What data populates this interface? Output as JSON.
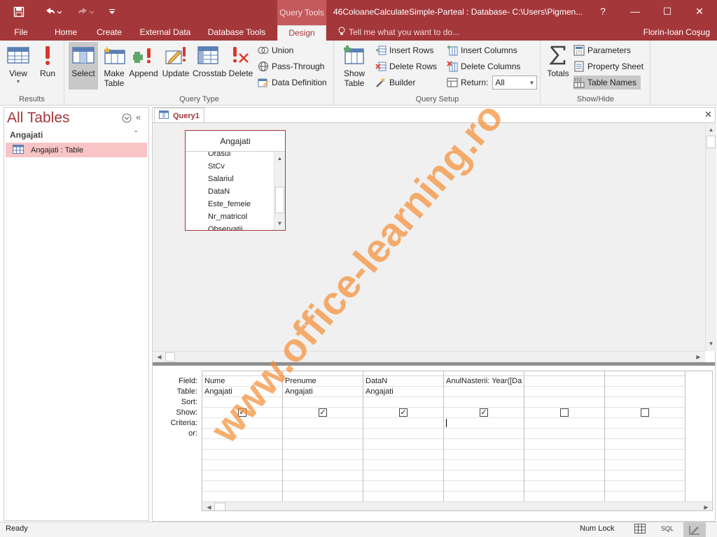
{
  "titlebar": {
    "context_tab": "Query Tools",
    "document_title": "46ColoaneCalculateSimple-Parteal : Database- C:\\Users\\Pigmen...",
    "help": "?",
    "minimize": "—",
    "restore": "☐",
    "close": "✕"
  },
  "ribbon_tabs": {
    "file": "File",
    "home": "Home",
    "create": "Create",
    "external_data": "External Data",
    "database_tools": "Database Tools",
    "design": "Design",
    "tell_me": "Tell me what you want to do...",
    "user": "Florin-Ioan Coşug"
  },
  "ribbon": {
    "results": {
      "label": "Results",
      "view": "View",
      "run": "Run"
    },
    "query_type": {
      "label": "Query Type",
      "select": "Select",
      "make_table": [
        "Make",
        "Table"
      ],
      "append": "Append",
      "update": "Update",
      "crosstab": "Crosstab",
      "delete": "Delete",
      "union": "Union",
      "pass_through": "Pass-Through",
      "data_definition": "Data Definition"
    },
    "query_setup": {
      "label": "Query Setup",
      "show_table": [
        "Show",
        "Table"
      ],
      "insert_rows": "Insert Rows",
      "delete_rows": "Delete Rows",
      "builder": "Builder",
      "insert_columns": "Insert Columns",
      "delete_columns": "Delete Columns",
      "return_label": "Return:",
      "return_value": "All"
    },
    "show_hide": {
      "label": "Show/Hide",
      "totals": "Totals",
      "parameters": "Parameters",
      "property_sheet": "Property Sheet",
      "table_names": "Table Names"
    }
  },
  "nav": {
    "title": "All Tables",
    "group": "Angajati",
    "item": "Angajati : Table"
  },
  "document": {
    "tab": "Query1",
    "table_box": {
      "title": "Angajati",
      "fields": [
        "Orasul",
        "StCv",
        "Salariul",
        "DataN",
        "Este_femeie",
        "Nr_matricol",
        "Observatii"
      ]
    },
    "grid": {
      "row_labels": [
        "Field:",
        "Table:",
        "Sort:",
        "Show:",
        "Criteria:",
        "or:"
      ],
      "columns": [
        {
          "field": "Nume",
          "table": "Angajati",
          "show": true
        },
        {
          "field": "Prenume",
          "table": "Angajati",
          "show": true
        },
        {
          "field": "DataN",
          "table": "Angajati",
          "show": true
        },
        {
          "field": "AnulNasterii: Year([Da",
          "table": "",
          "show": true
        },
        {
          "field": "",
          "table": "",
          "show": false
        },
        {
          "field": "",
          "table": "",
          "show": false
        }
      ]
    }
  },
  "status": {
    "text": "Ready",
    "num_lock": "Num Lock",
    "sql": "SQL"
  },
  "watermark": "www.office-learning.ro",
  "colors": {
    "accent": "#a4373a",
    "watermark": "#f58c32"
  }
}
